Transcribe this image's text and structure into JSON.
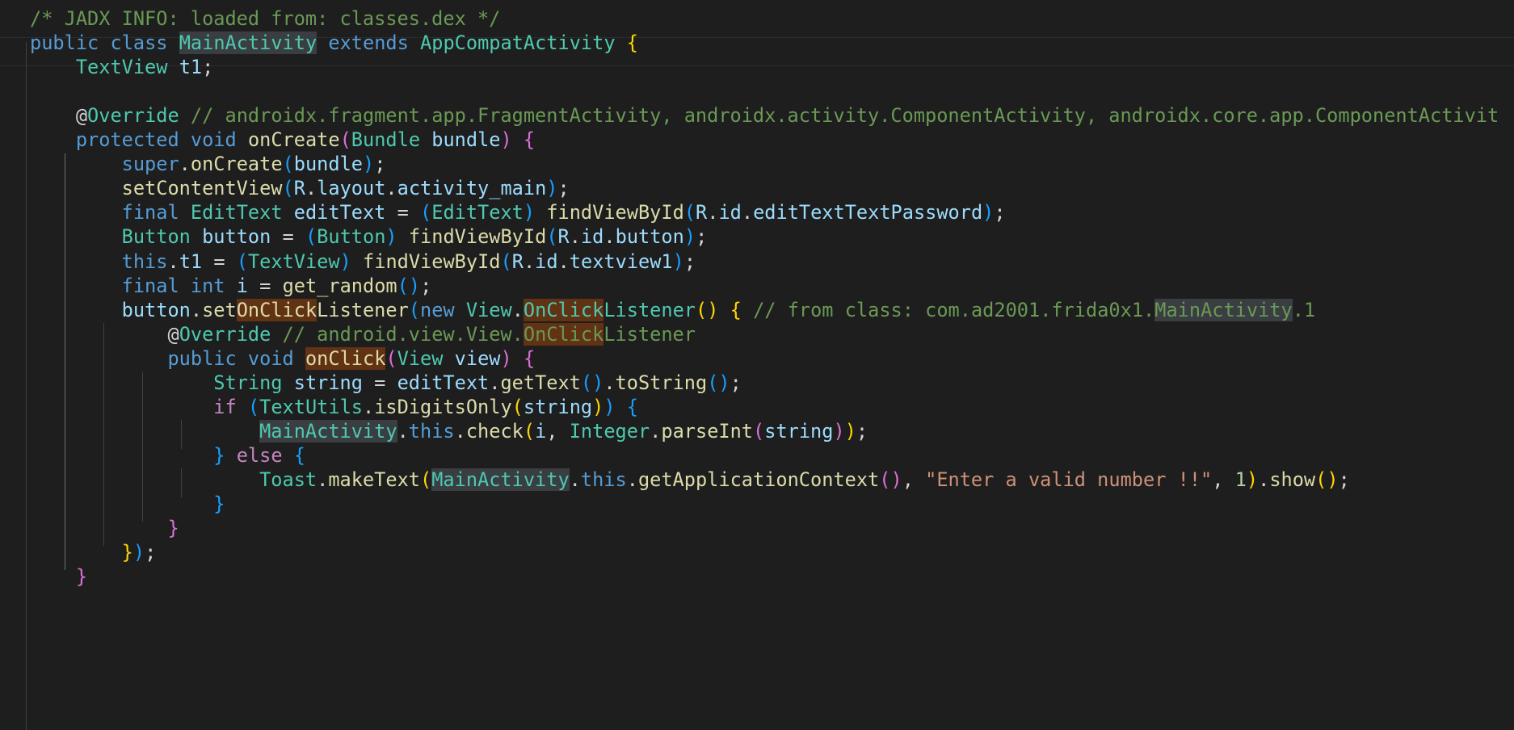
{
  "editor": {
    "language": "java",
    "theme": "dark",
    "lines": [
      [
        [
          "/* JADX INFO: loaded from: classes.dex */",
          "comment"
        ]
      ],
      [
        [
          "public",
          "kw"
        ],
        [
          " ",
          "plain"
        ],
        [
          "class",
          "kw"
        ],
        [
          " ",
          "plain"
        ],
        [
          "MainActivity",
          "type",
          "sel"
        ],
        [
          " ",
          "plain"
        ],
        [
          "extends",
          "kw"
        ],
        [
          " ",
          "plain"
        ],
        [
          "AppCompatActivity",
          "type"
        ],
        [
          " ",
          "plain"
        ],
        [
          "{",
          "b1"
        ]
      ],
      [
        [
          "    ",
          "plain"
        ],
        [
          "TextView",
          "type"
        ],
        [
          " ",
          "plain"
        ],
        [
          "t1",
          "var"
        ],
        [
          ";",
          "plain"
        ]
      ],
      [],
      [
        [
          "    ",
          "plain"
        ],
        [
          "@",
          "plain"
        ],
        [
          "Override",
          "type"
        ],
        [
          " ",
          "plain"
        ],
        [
          "// androidx.fragment.app.FragmentActivity, androidx.activity.ComponentActivity, androidx.core.app.ComponentActivit",
          "comment"
        ]
      ],
      [
        [
          "    ",
          "plain"
        ],
        [
          "protected",
          "kw"
        ],
        [
          " ",
          "plain"
        ],
        [
          "void",
          "kw"
        ],
        [
          " ",
          "plain"
        ],
        [
          "onCreate",
          "fn"
        ],
        [
          "(",
          "b2"
        ],
        [
          "Bundle",
          "type"
        ],
        [
          " ",
          "plain"
        ],
        [
          "bundle",
          "var"
        ],
        [
          ")",
          "b2"
        ],
        [
          " ",
          "plain"
        ],
        [
          "{",
          "b2"
        ]
      ],
      [
        [
          "        ",
          "plain"
        ],
        [
          "super",
          "kw"
        ],
        [
          ".",
          "plain"
        ],
        [
          "onCreate",
          "fn"
        ],
        [
          "(",
          "b3"
        ],
        [
          "bundle",
          "var"
        ],
        [
          ")",
          "b3"
        ],
        [
          ";",
          "plain"
        ]
      ],
      [
        [
          "        ",
          "plain"
        ],
        [
          "setContentView",
          "fn"
        ],
        [
          "(",
          "b3"
        ],
        [
          "R",
          "var"
        ],
        [
          ".",
          "plain"
        ],
        [
          "layout",
          "var"
        ],
        [
          ".",
          "plain"
        ],
        [
          "activity_main",
          "var"
        ],
        [
          ")",
          "b3"
        ],
        [
          ";",
          "plain"
        ]
      ],
      [
        [
          "        ",
          "plain"
        ],
        [
          "final",
          "kw"
        ],
        [
          " ",
          "plain"
        ],
        [
          "EditText",
          "type"
        ],
        [
          " ",
          "plain"
        ],
        [
          "editText",
          "var"
        ],
        [
          " = ",
          "plain"
        ],
        [
          "(",
          "b3"
        ],
        [
          "EditText",
          "type"
        ],
        [
          ")",
          "b3"
        ],
        [
          " ",
          "plain"
        ],
        [
          "findViewById",
          "fn"
        ],
        [
          "(",
          "b3"
        ],
        [
          "R",
          "var"
        ],
        [
          ".",
          "plain"
        ],
        [
          "id",
          "var"
        ],
        [
          ".",
          "plain"
        ],
        [
          "editTextTextPassword",
          "var"
        ],
        [
          ")",
          "b3"
        ],
        [
          ";",
          "plain"
        ]
      ],
      [
        [
          "        ",
          "plain"
        ],
        [
          "Button",
          "type"
        ],
        [
          " ",
          "plain"
        ],
        [
          "button",
          "var"
        ],
        [
          " = ",
          "plain"
        ],
        [
          "(",
          "b3"
        ],
        [
          "Button",
          "type"
        ],
        [
          ")",
          "b3"
        ],
        [
          " ",
          "plain"
        ],
        [
          "findViewById",
          "fn"
        ],
        [
          "(",
          "b3"
        ],
        [
          "R",
          "var"
        ],
        [
          ".",
          "plain"
        ],
        [
          "id",
          "var"
        ],
        [
          ".",
          "plain"
        ],
        [
          "button",
          "var"
        ],
        [
          ")",
          "b3"
        ],
        [
          ";",
          "plain"
        ]
      ],
      [
        [
          "        ",
          "plain"
        ],
        [
          "this",
          "kw"
        ],
        [
          ".",
          "plain"
        ],
        [
          "t1",
          "var"
        ],
        [
          " = ",
          "plain"
        ],
        [
          "(",
          "b3"
        ],
        [
          "TextView",
          "type"
        ],
        [
          ")",
          "b3"
        ],
        [
          " ",
          "plain"
        ],
        [
          "findViewById",
          "fn"
        ],
        [
          "(",
          "b3"
        ],
        [
          "R",
          "var"
        ],
        [
          ".",
          "plain"
        ],
        [
          "id",
          "var"
        ],
        [
          ".",
          "plain"
        ],
        [
          "textview1",
          "var"
        ],
        [
          ")",
          "b3"
        ],
        [
          ";",
          "plain"
        ]
      ],
      [
        [
          "        ",
          "plain"
        ],
        [
          "final",
          "kw"
        ],
        [
          " ",
          "plain"
        ],
        [
          "int",
          "kw"
        ],
        [
          " ",
          "plain"
        ],
        [
          "i",
          "var"
        ],
        [
          " = ",
          "plain"
        ],
        [
          "get_random",
          "fn"
        ],
        [
          "(",
          "b3"
        ],
        [
          ")",
          "b3"
        ],
        [
          ";",
          "plain"
        ]
      ],
      [
        [
          "        ",
          "plain"
        ],
        [
          "button",
          "var"
        ],
        [
          ".",
          "plain"
        ],
        [
          "set",
          "fn"
        ],
        [
          "OnClick",
          "fn",
          "find"
        ],
        [
          "Listener",
          "fn"
        ],
        [
          "(",
          "b3"
        ],
        [
          "new",
          "kw"
        ],
        [
          " ",
          "plain"
        ],
        [
          "View",
          "type"
        ],
        [
          ".",
          "plain"
        ],
        [
          "OnClick",
          "type",
          "find"
        ],
        [
          "Listener",
          "type"
        ],
        [
          "(",
          "b1"
        ],
        [
          ")",
          "b1"
        ],
        [
          " ",
          "plain"
        ],
        [
          "{",
          "b1"
        ],
        [
          " ",
          "plain"
        ],
        [
          "// from class: com.ad2001.frida0x1.",
          "comment"
        ],
        [
          "MainActivity",
          "comment",
          "sel"
        ],
        [
          ".1",
          "comment"
        ]
      ],
      [
        [
          "            ",
          "plain"
        ],
        [
          "@",
          "plain"
        ],
        [
          "Override",
          "type"
        ],
        [
          " ",
          "plain"
        ],
        [
          "// android.view.View.",
          "comment"
        ],
        [
          "OnClick",
          "comment",
          "find"
        ],
        [
          "Listener",
          "comment"
        ]
      ],
      [
        [
          "            ",
          "plain"
        ],
        [
          "public",
          "kw"
        ],
        [
          " ",
          "plain"
        ],
        [
          "void",
          "kw"
        ],
        [
          " ",
          "plain"
        ],
        [
          "onClick",
          "fn",
          "find"
        ],
        [
          "(",
          "b2"
        ],
        [
          "View",
          "type"
        ],
        [
          " ",
          "plain"
        ],
        [
          "view",
          "var"
        ],
        [
          ")",
          "b2"
        ],
        [
          " ",
          "plain"
        ],
        [
          "{",
          "b2"
        ]
      ],
      [
        [
          "                ",
          "plain"
        ],
        [
          "String",
          "type"
        ],
        [
          " ",
          "plain"
        ],
        [
          "string",
          "var"
        ],
        [
          " = ",
          "plain"
        ],
        [
          "editText",
          "var"
        ],
        [
          ".",
          "plain"
        ],
        [
          "getText",
          "fn"
        ],
        [
          "(",
          "b3"
        ],
        [
          ")",
          "b3"
        ],
        [
          ".",
          "plain"
        ],
        [
          "toString",
          "fn"
        ],
        [
          "(",
          "b3"
        ],
        [
          ")",
          "b3"
        ],
        [
          ";",
          "plain"
        ]
      ],
      [
        [
          "                ",
          "plain"
        ],
        [
          "if",
          "ctrl"
        ],
        [
          " ",
          "plain"
        ],
        [
          "(",
          "b3"
        ],
        [
          "TextUtils",
          "type"
        ],
        [
          ".",
          "plain"
        ],
        [
          "isDigitsOnly",
          "fn"
        ],
        [
          "(",
          "b1"
        ],
        [
          "string",
          "var"
        ],
        [
          ")",
          "b1"
        ],
        [
          ")",
          "b3"
        ],
        [
          " ",
          "plain"
        ],
        [
          "{",
          "b3"
        ]
      ],
      [
        [
          "                    ",
          "plain"
        ],
        [
          "MainActivity",
          "type",
          "sel"
        ],
        [
          ".",
          "plain"
        ],
        [
          "this",
          "kw"
        ],
        [
          ".",
          "plain"
        ],
        [
          "check",
          "fn"
        ],
        [
          "(",
          "b1"
        ],
        [
          "i",
          "var"
        ],
        [
          ", ",
          "plain"
        ],
        [
          "Integer",
          "type"
        ],
        [
          ".",
          "plain"
        ],
        [
          "parseInt",
          "fn"
        ],
        [
          "(",
          "b2"
        ],
        [
          "string",
          "var"
        ],
        [
          ")",
          "b2"
        ],
        [
          ")",
          "b1"
        ],
        [
          ";",
          "plain"
        ]
      ],
      [
        [
          "                ",
          "plain"
        ],
        [
          "}",
          "b3"
        ],
        [
          " ",
          "plain"
        ],
        [
          "else",
          "ctrl"
        ],
        [
          " ",
          "plain"
        ],
        [
          "{",
          "b3"
        ]
      ],
      [
        [
          "                    ",
          "plain"
        ],
        [
          "Toast",
          "type"
        ],
        [
          ".",
          "plain"
        ],
        [
          "makeText",
          "fn"
        ],
        [
          "(",
          "b1"
        ],
        [
          "MainActivity",
          "type",
          "sel"
        ],
        [
          ".",
          "plain"
        ],
        [
          "this",
          "kw"
        ],
        [
          ".",
          "plain"
        ],
        [
          "getApplicationContext",
          "fn"
        ],
        [
          "(",
          "b2"
        ],
        [
          ")",
          "b2"
        ],
        [
          ", ",
          "plain"
        ],
        [
          "\"Enter a valid number !!\"",
          "str"
        ],
        [
          ", ",
          "plain"
        ],
        [
          "1",
          "num"
        ],
        [
          ")",
          "b1"
        ],
        [
          ".",
          "plain"
        ],
        [
          "show",
          "fn"
        ],
        [
          "(",
          "b1"
        ],
        [
          ")",
          "b1"
        ],
        [
          ";",
          "plain"
        ]
      ],
      [
        [
          "                ",
          "plain"
        ],
        [
          "}",
          "b3"
        ]
      ],
      [
        [
          "            ",
          "plain"
        ],
        [
          "}",
          "b2"
        ]
      ],
      [
        [
          "        ",
          "plain"
        ],
        [
          "}",
          "b1"
        ],
        [
          ")",
          "b3"
        ],
        [
          ";",
          "plain"
        ]
      ],
      [
        [
          "    ",
          "plain"
        ],
        [
          "}",
          "b2"
        ]
      ]
    ]
  }
}
